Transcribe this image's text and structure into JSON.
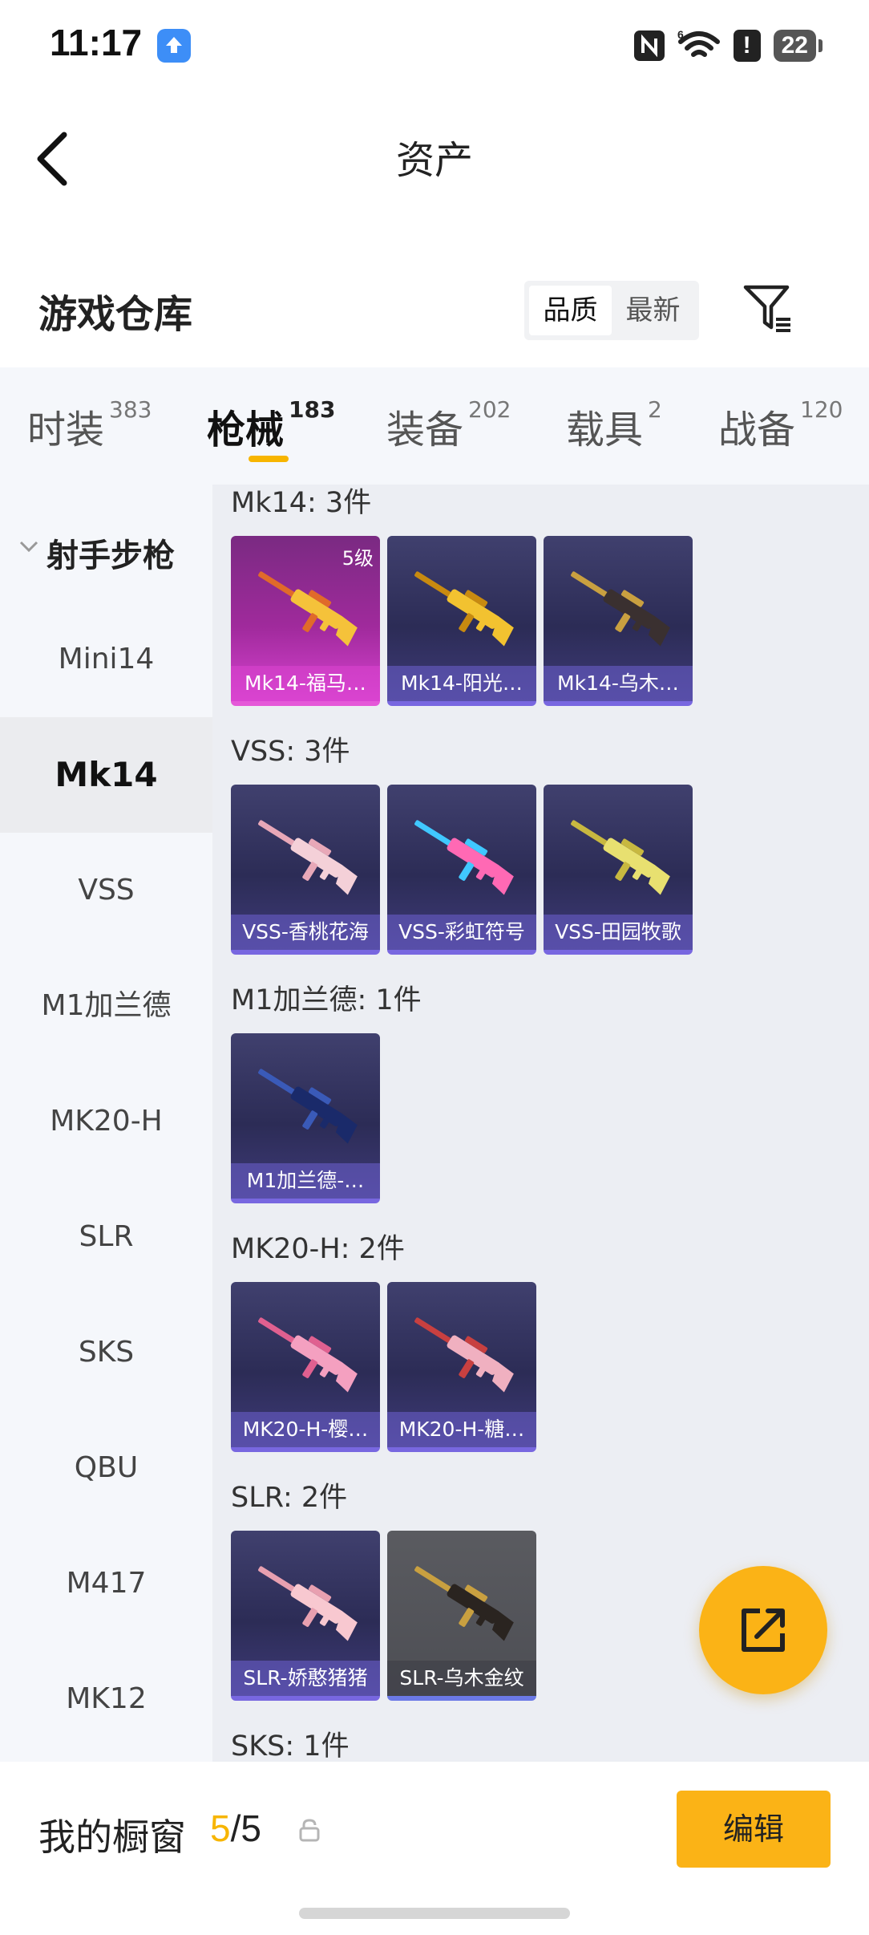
{
  "status_bar": {
    "time": "11:17",
    "battery": "22"
  },
  "nav": {
    "title": "资产"
  },
  "warehouse": {
    "title": "游戏仓库",
    "sort_quality": "品质",
    "sort_latest": "最新"
  },
  "tabs": [
    {
      "label": "时装",
      "count": "383"
    },
    {
      "label": "枪械",
      "count": "183"
    },
    {
      "label": "装备",
      "count": "202"
    },
    {
      "label": "载具",
      "count": "2"
    },
    {
      "label": "战备",
      "count": "120"
    }
  ],
  "side_menu": {
    "group": "射手步枪",
    "items": [
      "Mini14",
      "Mk14",
      "VSS",
      "M1加兰德",
      "MK20-H",
      "SLR",
      "SKS",
      "QBU",
      "M417",
      "MK12"
    ]
  },
  "groups": [
    {
      "title": "Mk14: 3件",
      "items": [
        {
          "label": "Mk14-福马…",
          "level": "5级",
          "colors": [
            "#f5c23a",
            "#e06a2a"
          ]
        },
        {
          "label": "Mk14-阳光…",
          "colors": [
            "#f2c230",
            "#c88a10"
          ]
        },
        {
          "label": "Mk14-乌木…",
          "colors": [
            "#3a3030",
            "#c9a040"
          ]
        }
      ]
    },
    {
      "title": "VSS: 3件",
      "items": [
        {
          "label": "VSS-香桃花海",
          "colors": [
            "#f4d0d8",
            "#e8a8b8"
          ]
        },
        {
          "label": "VSS-彩虹符号",
          "colors": [
            "#ff69b4",
            "#40c8ff"
          ]
        },
        {
          "label": "VSS-田园牧歌",
          "colors": [
            "#e8e070",
            "#c8b840"
          ]
        }
      ]
    },
    {
      "title": "M1加兰德: 1件",
      "items": [
        {
          "label": "M1加兰德-…",
          "colors": [
            "#1a2a6a",
            "#3a5ab8"
          ]
        }
      ]
    },
    {
      "title": "MK20-H: 2件",
      "items": [
        {
          "label": "MK20-H-樱…",
          "colors": [
            "#f4a0c0",
            "#e06090"
          ]
        },
        {
          "label": "MK20-H-糖…",
          "colors": [
            "#f0b0c0",
            "#c84040"
          ]
        }
      ]
    },
    {
      "title": "SLR: 2件",
      "items": [
        {
          "label": "SLR-娇憨猪猪",
          "colors": [
            "#f8c8d0",
            "#e8a0b0"
          ]
        },
        {
          "label": "SLR-乌木金纹",
          "colors": [
            "#2a2420",
            "#c9a040"
          ]
        }
      ]
    },
    {
      "title": "SKS: 1件",
      "items": []
    }
  ],
  "bottom": {
    "showcase_label": "我的橱窗",
    "current": "5",
    "sep": "/",
    "total": "5",
    "edit": "编辑"
  },
  "colors": {
    "accent": "#fbb316",
    "tab_underline": "#f7b500"
  }
}
